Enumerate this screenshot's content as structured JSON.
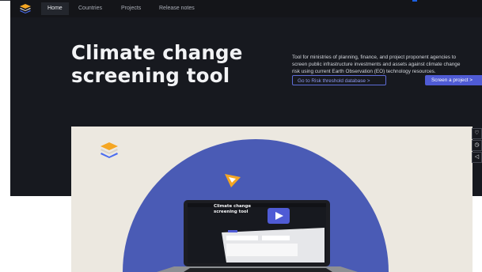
{
  "nav": {
    "items": [
      "Home",
      "Countries",
      "Projects",
      "Release notes"
    ]
  },
  "hero": {
    "title_line1": "Climate change",
    "title_line2": "screening tool",
    "description_lines": [
      "Tool for ministries of planning, finance, and project proponent agencies to",
      "screen public infrastructure investments and assets against climate change",
      "risk using current Earth Observation (EO) technology resources."
    ],
    "btn_outline": "Go to Risk threshold database  >",
    "btn_primary": "Screen a project  >"
  },
  "video_preview": {
    "title_line1": "Climate change",
    "title_line2": "screening tool"
  },
  "side_icons": [
    "heart-icon",
    "clock-icon",
    "send-icon"
  ],
  "colors": {
    "dark_bg": "#17191f",
    "accent": "#4f5bd5",
    "blob": "#4a5bb5",
    "pointer": "#f5a623"
  }
}
